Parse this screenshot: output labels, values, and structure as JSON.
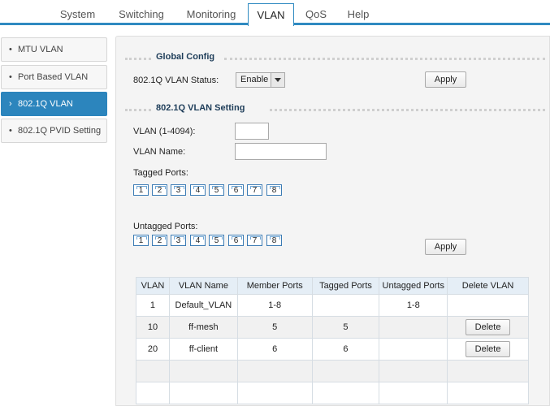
{
  "tabs": [
    "System",
    "Switching",
    "Monitoring",
    "VLAN",
    "QoS",
    "Help"
  ],
  "sidebar": {
    "items": [
      {
        "label": "MTU VLAN",
        "bullet": "•"
      },
      {
        "label": "Port Based VLAN",
        "bullet": "•"
      },
      {
        "label": "802.1Q VLAN",
        "bullet": "›"
      },
      {
        "label": "802.1Q PVID Setting",
        "bullet": "•"
      }
    ],
    "active_index": 2
  },
  "global_config": {
    "title": "Global Config",
    "status_label": "802.1Q VLAN Status:",
    "status_value": "Enable",
    "apply_label": "Apply"
  },
  "vlan_setting": {
    "title": "802.1Q VLAN Setting",
    "vlan_id_label": "VLAN (1-4094):",
    "vlan_id_value": "",
    "vlan_name_label": "VLAN Name:",
    "vlan_name_value": "",
    "tagged_label": "Tagged Ports:",
    "untagged_label": "Untagged Ports:",
    "ports": [
      "1",
      "2",
      "3",
      "4",
      "5",
      "6",
      "7",
      "8"
    ],
    "apply_label": "Apply"
  },
  "vlan_table": {
    "headers": [
      "VLAN",
      "VLAN Name",
      "Member Ports",
      "Tagged Ports",
      "Untagged Ports",
      "Delete VLAN"
    ],
    "rows": [
      [
        "1",
        "Default_VLAN",
        "1-8",
        "",
        "1-8",
        ""
      ],
      [
        "10",
        "ff-mesh",
        "5",
        "5",
        "",
        "Delete"
      ],
      [
        "20",
        "ff-client",
        "6",
        "6",
        "",
        "Delete"
      ],
      [
        "",
        "",
        "",
        "",
        "",
        ""
      ],
      [
        "",
        "",
        "",
        "",
        "",
        ""
      ]
    ]
  },
  "colors": {
    "accent": "#2f8ac1",
    "sidebar_active": "#2c85bd",
    "section_title": "#1e3d59"
  }
}
